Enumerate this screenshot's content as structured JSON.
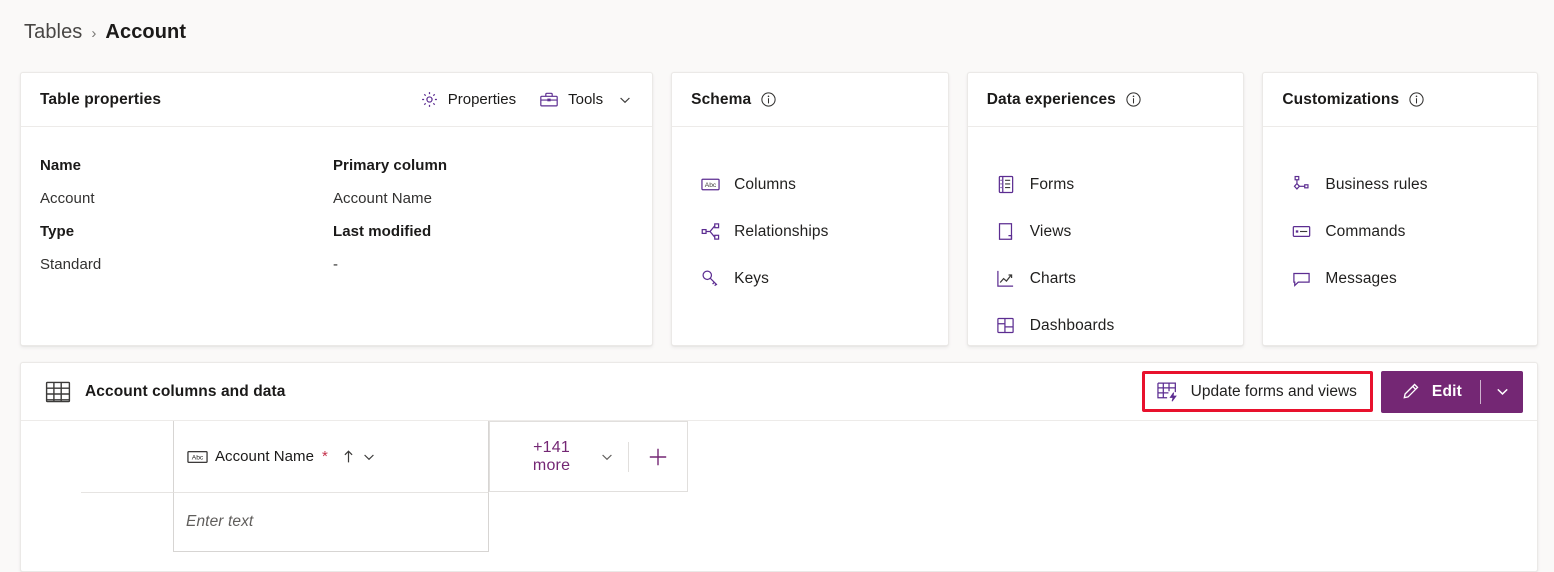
{
  "breadcrumb": {
    "parent": "Tables",
    "separator": "›",
    "current": "Account"
  },
  "table_properties": {
    "title": "Table properties",
    "actions": {
      "properties_label": "Properties",
      "properties_icon": "gear-icon",
      "tools_label": "Tools",
      "tools_icon": "toolbox-icon",
      "tools_chevron_icon": "chevron-down-icon"
    },
    "fields": [
      {
        "label": "Name",
        "value": "Account"
      },
      {
        "label": "Primary column",
        "value": "Account Name"
      },
      {
        "label": "Type",
        "value": "Standard"
      },
      {
        "label": "Last modified",
        "value": "-"
      }
    ]
  },
  "schema": {
    "title": "Schema",
    "info_icon": "info-icon",
    "items": [
      {
        "label": "Columns",
        "icon": "abc-column-icon"
      },
      {
        "label": "Relationships",
        "icon": "relationships-icon"
      },
      {
        "label": "Keys",
        "icon": "key-icon"
      }
    ]
  },
  "data_experiences": {
    "title": "Data experiences",
    "info_icon": "info-icon",
    "items": [
      {
        "label": "Forms",
        "icon": "form-icon"
      },
      {
        "label": "Views",
        "icon": "view-page-icon"
      },
      {
        "label": "Charts",
        "icon": "line-chart-icon"
      },
      {
        "label": "Dashboards",
        "icon": "dashboard-icon"
      }
    ]
  },
  "customizations": {
    "title": "Customizations",
    "info_icon": "info-icon",
    "items": [
      {
        "label": "Business rules",
        "icon": "business-rules-icon"
      },
      {
        "label": "Commands",
        "icon": "commands-icon"
      },
      {
        "label": "Messages",
        "icon": "message-icon"
      }
    ]
  },
  "data_panel": {
    "icon": "table-grid-icon",
    "title": "Account columns and data",
    "update_button": {
      "label": "Update forms and views",
      "icon": "update-table-icon",
      "highlight_color": "#e8112d",
      "highlighted": true
    },
    "edit_button": {
      "label": "Edit",
      "icon": "pencil-icon",
      "chevron_icon": "chevron-down-icon",
      "background_color": "#742774",
      "text_color": "#ffffff"
    },
    "grid": {
      "column_header": {
        "icon": "abc-text-icon",
        "label": "Account Name",
        "required_marker": "*",
        "sort_icon": "sort-ascending-arrow",
        "menu_icon": "chevron-down-icon"
      },
      "more_columns": {
        "label": "+141 more",
        "chevron_icon": "chevron-down-icon",
        "add_icon": "plus-icon",
        "accent_color": "#742774"
      },
      "row_cell_placeholder": "Enter text"
    }
  }
}
